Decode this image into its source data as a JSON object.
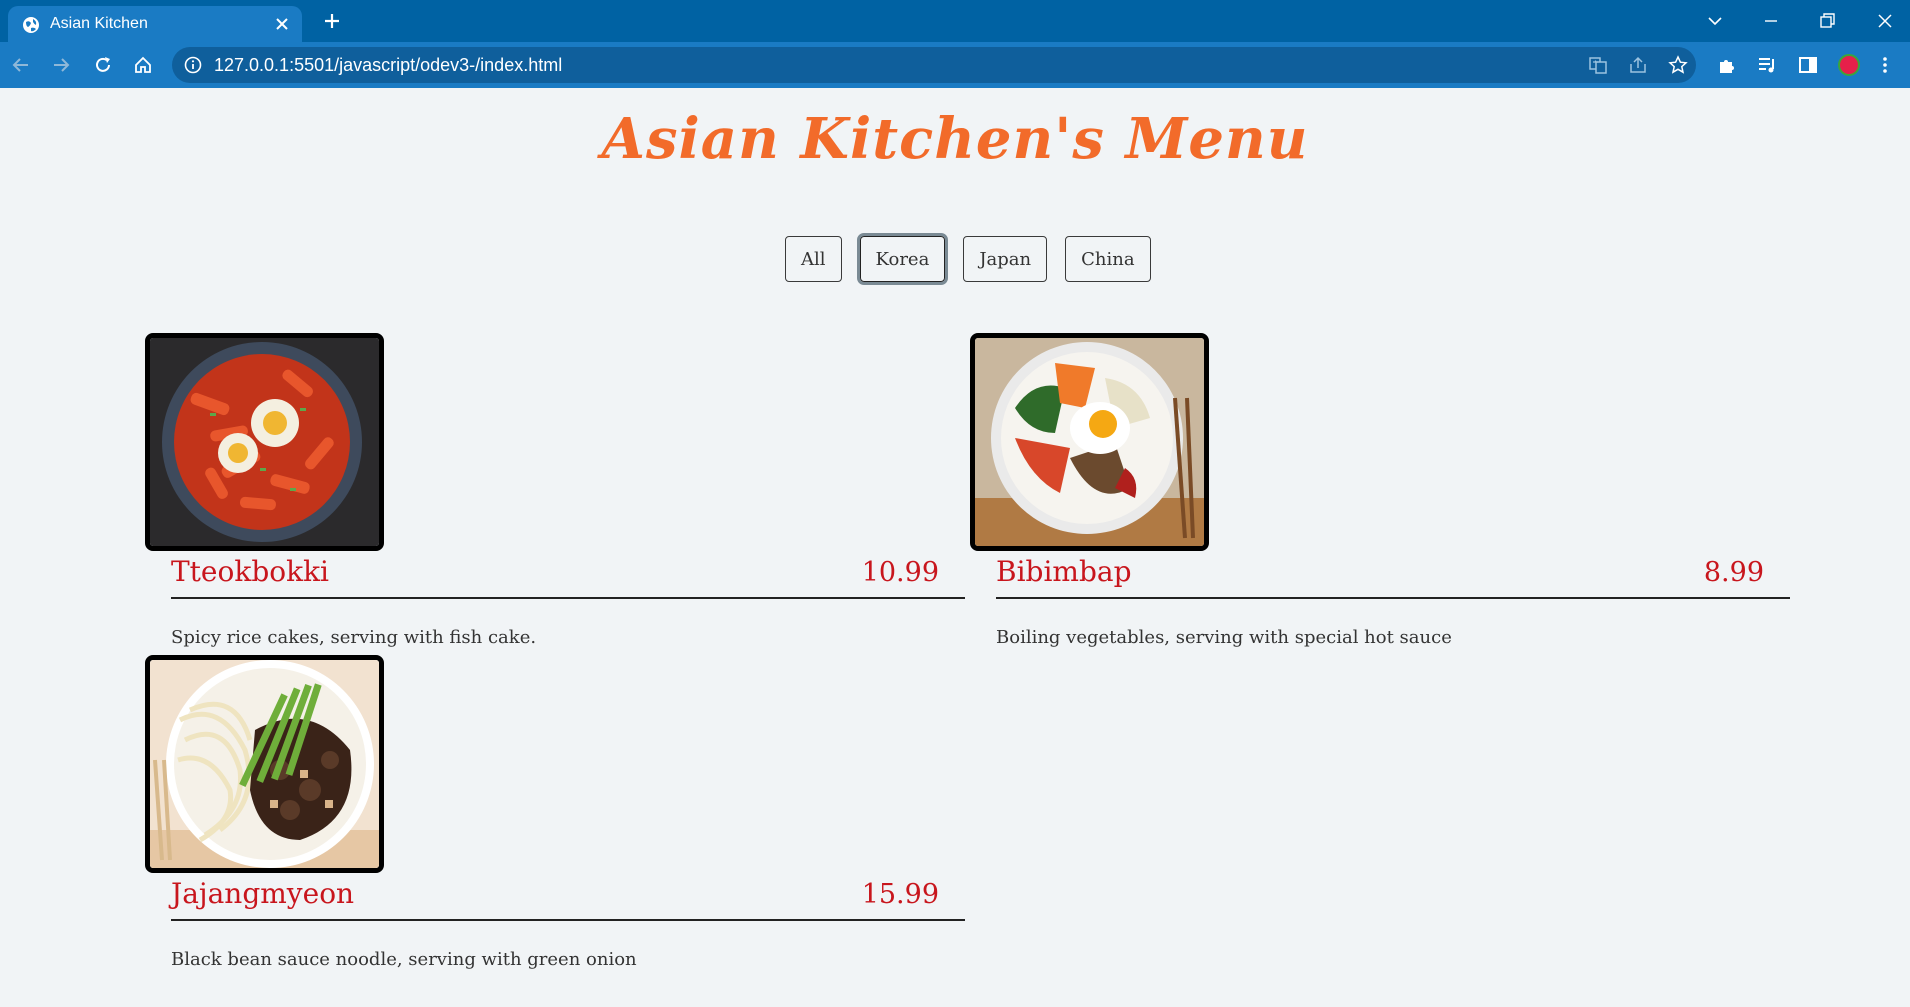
{
  "browser": {
    "tab_title": "Asian Kitchen",
    "url": "127.0.0.1:5501/javascript/odev3-/index.html"
  },
  "page": {
    "title": "Asian Kitchen's Menu",
    "filters": [
      {
        "label": "All",
        "active": false
      },
      {
        "label": "Korea",
        "active": true
      },
      {
        "label": "Japan",
        "active": false
      },
      {
        "label": "China",
        "active": false
      }
    ]
  },
  "menu": [
    {
      "name": "Tteokbokki",
      "price": "10.99",
      "desc": "Spicy rice cakes, serving with fish cake.",
      "image": "tteokbokki-photo"
    },
    {
      "name": "Bibimbap",
      "price": "8.99",
      "desc": "Boiling vegetables, serving with special hot sauce",
      "image": "bibimbap-photo"
    },
    {
      "name": "Jajangmyeon",
      "price": "15.99",
      "desc": "Black bean sauce noodle, serving with green onion",
      "image": "jajangmyeon-photo"
    }
  ],
  "colors": {
    "title": "#f26b2a",
    "dish_text": "#c8161d",
    "chrome_dark": "#0062a3",
    "chrome_light": "#1a7bc4"
  }
}
